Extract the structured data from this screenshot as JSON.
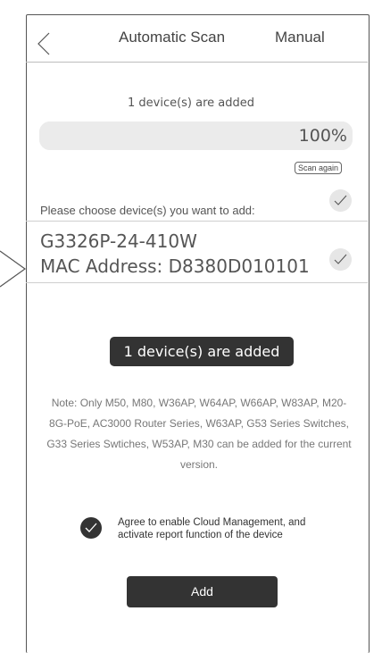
{
  "header": {
    "title": "Automatic Scan",
    "manual_label": "Manual"
  },
  "scan": {
    "added_text": "1 device(s) are added",
    "progress_percent": 100,
    "progress_label": "100%",
    "scan_again_label": "Scan again"
  },
  "choose": {
    "label": "Please choose device(s) you want to add:",
    "checked": true
  },
  "devices": [
    {
      "name": "G3326P-24-410W",
      "mac": "MAC Address: D8380D010101",
      "checked": true
    }
  ],
  "toast": {
    "text": "1 device(s) are added"
  },
  "note": {
    "text": "Note: Only M50, M80, W36AP, W64AP, W66AP, W83AP, M20-8G-PoE, AC3000 Router Series, W63AP, G53 Series Switches, G33 Series Swtiches, W53AP, M30 can be added for the current version."
  },
  "agree": {
    "text": "Agree to enable Cloud Management, and activate report function of the device",
    "checked": true
  },
  "add_button": {
    "label": "Add"
  },
  "icons": {
    "back": "chevron-left-icon",
    "side_arrow": "chevron-right-icon",
    "check": "checkmark-icon"
  },
  "colors": {
    "dark": "#333333",
    "light_gray": "#ebebeb",
    "check_bg": "#e6e6e6"
  }
}
